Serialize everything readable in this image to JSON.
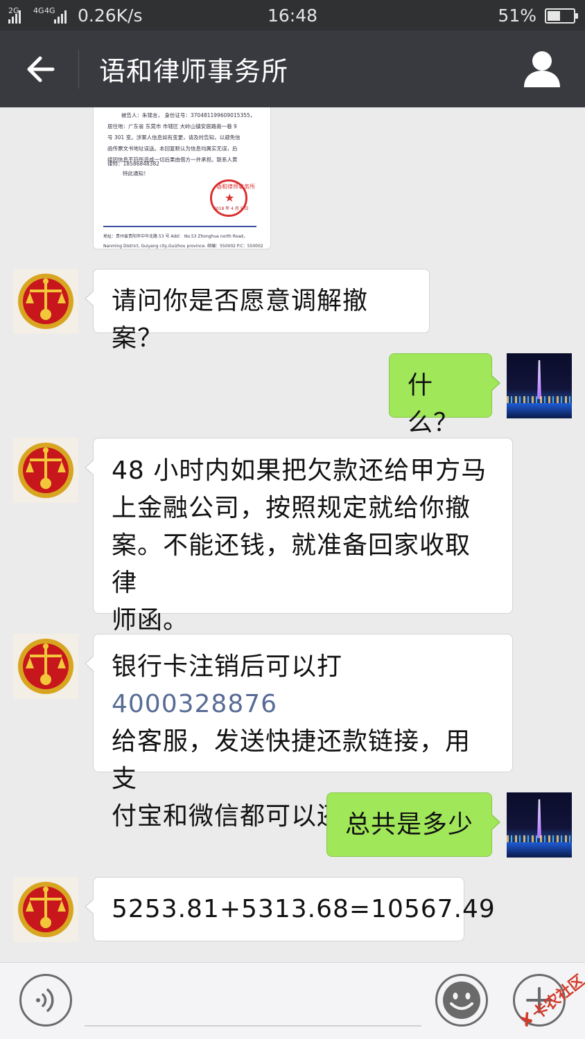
{
  "status_bar": {
    "sim1_label": "2G",
    "sim2_label": "4G",
    "sim2_label_b": "4G",
    "net_speed": "0.26K/s",
    "time": "16:48",
    "battery_percent": "51%",
    "battery_level": 0.51
  },
  "header": {
    "title": "语和律师事务所",
    "back_icon": "back-arrow-icon",
    "profile_icon": "person-icon"
  },
  "document_image": {
    "lines": [
      "被告人：朱锦言，    身份证号：370481199609015355，",
      "居住地：广东省 东莞市 市辖区 大岭山镇安居路南一巷 9",
      "号 301 室。涉案人信息如有变更，请及时告知，以避免信",
      "函传票文书地址误送。本回复默认为信息均属实无误，后",
      "续因信息不符所造成一切后果由借方一并承担。联系人黄",
      "律师：18586848382",
      "特此通知！"
    ],
    "footer_line1": "地址：贵州省贵阳市中华北路 53 号    Add：  No.53 Zhonghua north Road，",
    "footer_line2": "Nanming District, Guiyang city,Guizhou province.    邮编：550002 P.C：550002",
    "seal_top": "语和律师事务所",
    "seal_bottom": "2018 年 4 月 5 日"
  },
  "messages": [
    {
      "side": "left",
      "avatar": "court-emblem",
      "text": "请问你是否愿意调解撤案？"
    },
    {
      "side": "right",
      "avatar": "city-night-photo",
      "text": "什么？"
    },
    {
      "side": "left",
      "avatar": "court-emblem",
      "lines": [
        "48 小时内如果把欠款还给甲方马",
        "上金融公司，按照规定就给你撤",
        "案。不能还钱，就准备回家收取律",
        "师函。"
      ]
    },
    {
      "side": "left",
      "avatar": "court-emblem",
      "line1_prefix": "银行卡注销后可以打 ",
      "phone": "4000328876",
      "lines_rest": [
        "给客服，发送快捷还款链接，用支",
        "付宝和微信都可以还款。"
      ]
    },
    {
      "side": "right",
      "avatar": "city-night-photo",
      "text": "总共是多少"
    },
    {
      "side": "left",
      "avatar": "court-emblem",
      "text": "5253.81+5313.68=10567.49"
    }
  ],
  "input_bar": {
    "voice_icon": "voice-icon",
    "emoji_icon": "emoji-icon",
    "plus_icon": "plus-icon"
  },
  "watermark": {
    "text": "卡农社区"
  },
  "colors": {
    "header_bg": "#393a3f",
    "status_bg": "#2f3133",
    "chat_bg": "#ebebeb",
    "bubble_green": "#a0e75a",
    "link": "#576b95"
  }
}
